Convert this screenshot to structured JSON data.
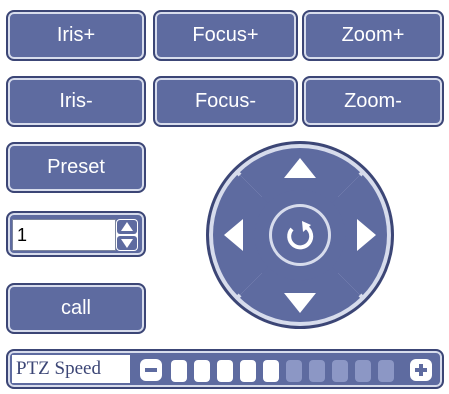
{
  "buttons": {
    "iris_plus": "Iris+",
    "focus_plus": "Focus+",
    "zoom_plus": "Zoom+",
    "iris_minus": "Iris-",
    "focus_minus": "Focus-",
    "zoom_minus": "Zoom-",
    "preset": "Preset",
    "call": "call"
  },
  "preset_input": {
    "value": "1"
  },
  "ptz_speed": {
    "label": "PTZ Speed",
    "level": 5,
    "max": 10,
    "active_color": "#ffffff",
    "inactive_color": "#8c97c5"
  },
  "dpad": {
    "up_icon": "arrow-up-icon",
    "down_icon": "arrow-down-icon",
    "left_icon": "arrow-left-icon",
    "right_icon": "arrow-right-icon",
    "center_icon": "refresh-icon"
  },
  "colors": {
    "accent": "#5e6ba0",
    "border": "#3c4676",
    "inner_border": "#d7dcec"
  }
}
